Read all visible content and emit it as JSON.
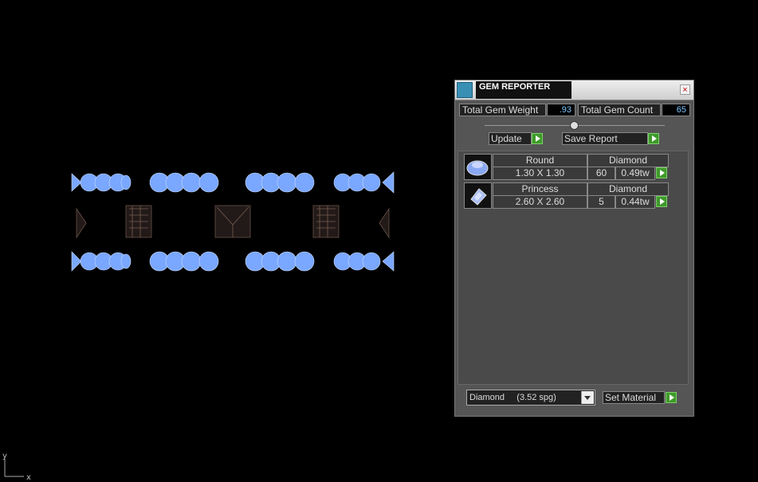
{
  "panel": {
    "title": "GEM REPORTER",
    "close_glyph": "×",
    "total_weight_label": "Total Gem Weight",
    "total_weight_value": ".93",
    "total_count_label": "Total Gem Count",
    "total_count_value": "65",
    "update_label": "Update",
    "save_report_label": "Save Report",
    "gems": [
      {
        "shape": "Round",
        "material": "Diamond",
        "size": "1.30 X 1.30",
        "count": "60",
        "weight": "0.49tw"
      },
      {
        "shape": "Princess",
        "material": "Diamond",
        "size": "2.60 X 2.60",
        "count": "5",
        "weight": "0.44tw"
      }
    ],
    "material_select": {
      "value": "Diamond     (3.52 spg)"
    },
    "set_material_label": "Set Material"
  },
  "viewport": {
    "axis_y": "y",
    "axis_x": "x"
  },
  "colors": {
    "gem_blue": "#7aa7ff",
    "panel_bg": "#555555",
    "go_green": "#3e9a2a",
    "value_text": "#7ec6ff"
  },
  "icons": [
    "gem-reporter-app-icon",
    "close-icon",
    "round-gem-icon",
    "princess-gem-icon",
    "go-arrow-icon",
    "dropdown-arrow-icon"
  ]
}
